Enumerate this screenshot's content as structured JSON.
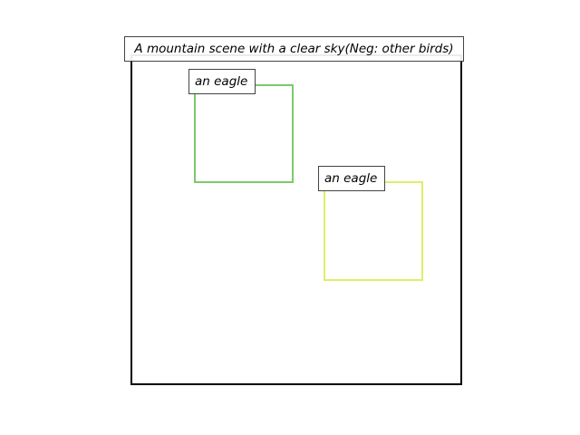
{
  "title": "A mountain scene with a clear sky(Neg: other birds)",
  "boxes": [
    {
      "label": "an eagle",
      "color": "#7ac96b"
    },
    {
      "label": "an eagle",
      "color": "#e0ee6a"
    }
  ]
}
